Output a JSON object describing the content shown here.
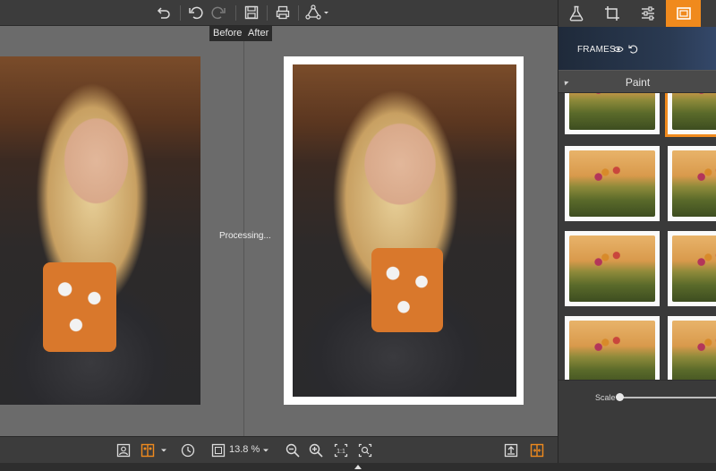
{
  "toolbar": {
    "before_label": "Before",
    "after_label": "After",
    "icons": [
      "undo-history-icon",
      "undo-icon",
      "redo-icon",
      "save-icon",
      "print-icon",
      "share-icon"
    ]
  },
  "canvas": {
    "status_text": "Processing..."
  },
  "bottombar": {
    "zoom_value": "13.8 %",
    "icons": [
      "single-view-icon",
      "split-view-icon",
      "rotate-icon",
      "fit-icon",
      "zoom-out-icon",
      "zoom-in-icon",
      "actual-size-icon",
      "fit-window-icon",
      "export-icon",
      "compare-icon"
    ]
  },
  "panel": {
    "tabs": [
      "effects-tab",
      "crop-tab",
      "adjust-tab",
      "frames-tab"
    ],
    "active_tab": "frames-tab",
    "header_title": "FRAMES",
    "section_title": "Paint",
    "scale_label": "Scale"
  },
  "colors": {
    "accent": "#f08a1d",
    "toolbar_bg": "#3c3c3c",
    "canvas_bg": "#6b6b6b"
  }
}
